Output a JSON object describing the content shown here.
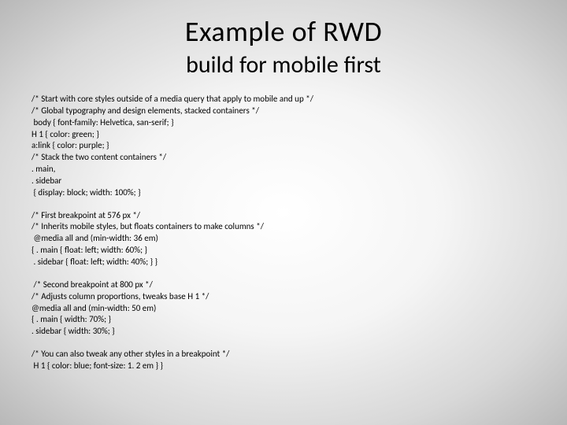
{
  "title": "Example of RWD",
  "subtitle": "build for mobile first",
  "block1": {
    "l0": "/* Start with core styles outside of a media query that apply to mobile and up */",
    "l1": "/* Global typography and design elements, stacked containers */",
    "l2": " body { font-family: Helvetica, san-serif; }",
    "l3": "H 1 { color: green; }",
    "l4": "a:link { color: purple; }",
    "l5": "/* Stack the two content containers */",
    "l6": ". main,",
    "l7": ". sidebar",
    "l8": " { display: block; width: 100%; }"
  },
  "block2": {
    "l0": "/* First breakpoint at 576 px */",
    "l1": "/* Inherits mobile styles, but floats containers to make columns */",
    "l2": " @media all and (min-width: 36 em)",
    "l3": "{ . main { float: left; width: 60%; }",
    "l4": " . sidebar { float: left; width: 40%; } }"
  },
  "block3": {
    "l0": " /* Second breakpoint at 800 px */",
    "l1": "/* Adjusts column proportions, tweaks base H 1 */",
    "l2": "@media all and (min-width: 50 em)",
    "l3": "{ . main { width: 70%; }",
    "l4": ". sidebar { width: 30%; }"
  },
  "block4": {
    "l0": "/* You can also tweak any other styles in a breakpoint */",
    "l1": " H 1 { color: blue; font-size: 1. 2 em } }"
  }
}
